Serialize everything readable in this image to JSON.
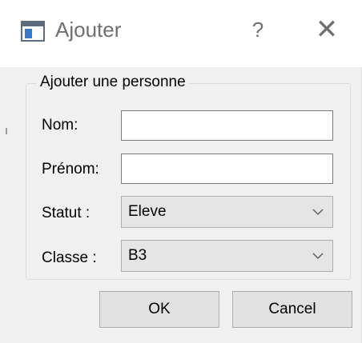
{
  "window": {
    "title": "Ajouter",
    "help_label": "?",
    "close_label": "✕",
    "icon": "window-app-icon"
  },
  "group": {
    "title": "Ajouter une personne"
  },
  "form": {
    "nom_label": "Nom:",
    "nom_value": "",
    "prenom_label": "Prénom:",
    "prenom_value": "",
    "statut_label": "Statut :",
    "statut_value": "Eleve",
    "classe_label": "Classe :",
    "classe_value": "B3"
  },
  "buttons": {
    "ok_label": "OK",
    "cancel_label": "Cancel"
  },
  "colors": {
    "dialog_bg": "#f0f0f0",
    "titlebar_bg": "#ffffff",
    "button_bg": "#e1e1e1"
  }
}
